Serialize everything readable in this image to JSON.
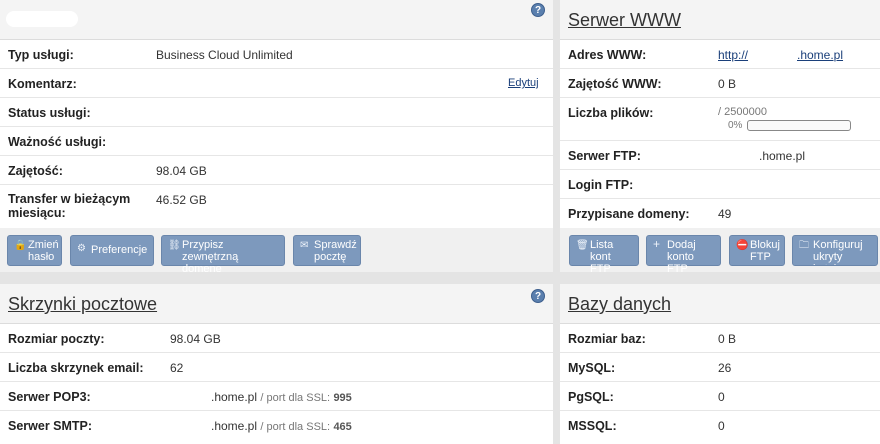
{
  "service": {
    "rows": [
      {
        "label": "Typ usługi:",
        "value": "Business Cloud Unlimited"
      },
      {
        "label": "Komentarz:",
        "value": "",
        "link": "Edytuj"
      },
      {
        "label": "Status usługi:",
        "value": ""
      },
      {
        "label": "Ważność usługi:",
        "value": ""
      },
      {
        "label": "Zajętość:",
        "value": "98.04 GB"
      },
      {
        "label": "Transfer w bieżącym miesiącu:",
        "value": "46.52 GB"
      }
    ],
    "buttons": [
      "Zmień hasło",
      "Preferencje",
      "Przypisz zewnętrzną domenę",
      "Sprawdź pocztę"
    ]
  },
  "www": {
    "title": "Serwer WWW",
    "address_label": "Adres WWW:",
    "address_part1": "http://",
    "address_part2": ".home.pl",
    "usage_label": "Zajętość WWW:",
    "usage_value": "0 B",
    "files_label": "Liczba plików:",
    "files_value": "/ 2500000",
    "files_percent_text": "0%",
    "files_progress": 0,
    "ftp_label": "Serwer FTP:",
    "ftp_value": ".home.pl",
    "login_label": "Login FTP:",
    "login_value": "",
    "domains_label": "Przypisane domeny:",
    "domains_value": "49",
    "buttons": [
      "Lista kont FTP",
      "Dodaj konto FTP",
      "Blokuj FTP",
      "Konfiguruj ukryty katalog"
    ]
  },
  "mail": {
    "title": "Skrzynki pocztowe",
    "size_label": "Rozmiar poczty:",
    "size_value": "98.04 GB",
    "count_label": "Liczba skrzynek email:",
    "count_value": "62",
    "pop3_label": "Serwer POP3:",
    "pop3_host": ".home.pl",
    "pop3_port_text": "/ port dla SSL:",
    "pop3_port": "995",
    "smtp_label": "Serwer SMTP:",
    "smtp_host": ".home.pl",
    "smtp_port_text": "/ port dla SSL:",
    "smtp_port": "465"
  },
  "db": {
    "title": "Bazy danych",
    "rows": [
      {
        "label": "Rozmiar baz:",
        "value": "0 B"
      },
      {
        "label": "MySQL:",
        "value": "26"
      },
      {
        "label": "PgSQL:",
        "value": "0"
      },
      {
        "label": "MSSQL:",
        "value": "0"
      }
    ]
  },
  "icons": {
    "help": "?",
    "lock": "🔒",
    "gear": "⚙",
    "link": "⛓",
    "mail": "✉",
    "trash": "🗑",
    "plus": "+",
    "block": "⛔",
    "folder": "🗀"
  }
}
